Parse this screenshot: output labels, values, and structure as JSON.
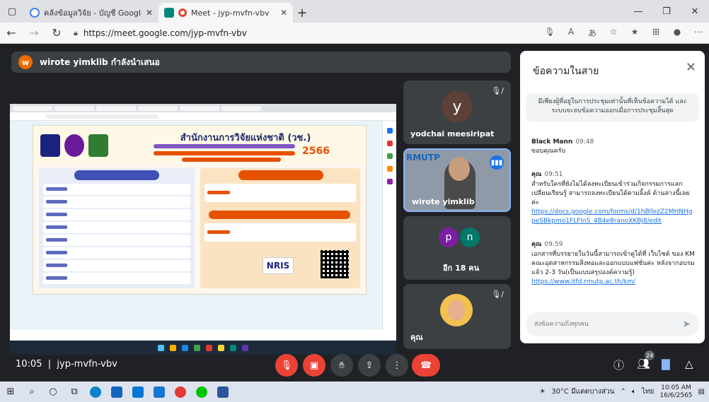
{
  "browser": {
    "tabs": [
      {
        "title": "คลังข้อมูลวิจัย - บัญชี Google",
        "active": false
      },
      {
        "title": "Meet - jyp-mvfn-vbv",
        "active": true
      }
    ],
    "new_tab": "+",
    "url": "https://meet.google.com/jyp-mvfn-vbv"
  },
  "meet": {
    "presenting_initial": "w",
    "presenting_text": "wirote yimklib กำลังนำเสนอ",
    "shared_screen": {
      "poster_title": "สำนักงานการวิจัยแห่งชาติ (วช.)",
      "poster_year": "2566",
      "nris": "NRIS"
    },
    "participants": [
      {
        "name": "yodchai meesiripat",
        "initial": "y",
        "muted": true
      },
      {
        "name": "wirote yimklib",
        "side_letters": "RMUTP",
        "speaking": true
      },
      {
        "name": "อีก 18 คน",
        "initials": [
          "p",
          "n"
        ]
      },
      {
        "name": "คุณ",
        "muted": true
      }
    ]
  },
  "chat": {
    "title": "ข้อความในสาย",
    "note": "มีเพียงผู้ที่อยู่ในการประชุมเท่านั้นที่เห็นข้อความได้ และระบบจะลบข้อความออกเมื่อการประชุมสิ้นสุด",
    "messages": [
      {
        "sender": "Black Mann",
        "time": "09:48",
        "text": "ขอบคุณครับ",
        "link": ""
      },
      {
        "sender": "คุณ",
        "time": "09:51",
        "text": "สำหรับใครที่ยังไม่ได้ลงทะเบียนเข้าร่วมกิจกรรมการแลกเปลี่ยนเรียนรู้ สามารถลงทะเบียนได้ตามลิ้งค์ ด้านล่างนี้เลยค่ะ",
        "link": "https://docs.google.com/forms/d/1hBllezZ2MHNHgpeSBkpmo1FLFlnS_4B4e8ranoXKBj8/edit"
      },
      {
        "sender": "คุณ",
        "time": "09:59",
        "text": "เอกสารที่บรรยายในวันนี้สามารถเข้าดูได้ที่ เว็บไซต์ ของ KM คณะอุตสาหกรรมสิ่งทอและออกแบบแฟชั่นค่ะ หลังจากอบรมแล้ว 2-3 วัน(เป็นแบบสรุปองค์ความรู้)",
        "link": "https://www.itfd.rmutp.ac.th/km/"
      }
    ],
    "input_placeholder": "ส่งข้อความถึงทุกคน"
  },
  "controls": {
    "time": "10:05",
    "meeting_code": "jyp-mvfn-vbv",
    "people_count": "24"
  },
  "taskbar": {
    "weather": "30°C มีแดดบางส่วน",
    "lang": "ไทย",
    "time": "10:05 AM",
    "date": "16/6/2565"
  },
  "colors": {
    "meet_bg": "#202124",
    "tile_bg": "#3c4043",
    "red": "#ea4335",
    "accent_blue": "#1a73e8"
  }
}
